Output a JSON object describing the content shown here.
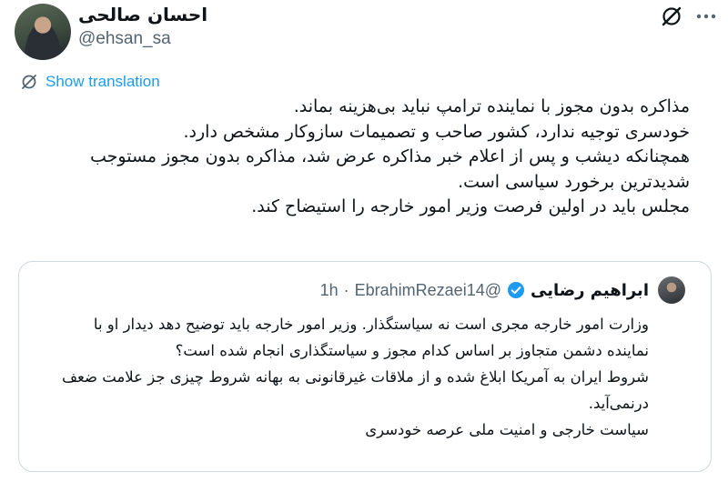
{
  "tweet": {
    "author_name": "احسان صالحی",
    "author_handle": "@ehsan_sa",
    "show_translation": "Show translation",
    "lines": [
      "مذاکره بدون مجوز با نماینده ترامپ نباید بی‌هزینه بماند.",
      "خودسری توجیه ندارد، کشور صاحب و تصمیمات سازوکار مشخص دارد.",
      "همچنانکه دیشب و پس از اعلام خبر مذاکره عرض شد، مذاکره بدون مجوز مستوجب",
      "شدیدترین برخورد سیاسی است.",
      "مجلس باید در اولین فرصت وزیر امور خارجه را استیضاح کند."
    ]
  },
  "quote": {
    "author_name": "ابراهیم رضایی",
    "author_handle": "@EbrahimRezaei14",
    "separator": "·",
    "time": "1h",
    "lines": [
      "وزارت امور خارجه مجری است نه سیاستگذار. وزیر امور خارجه باید توضیح دهد دیدار او با",
      "نماینده دشمن متجاوز بر اساس کدام مجوز و سیاستگذاری انجام شده است؟",
      "شروط ایران به آمریکا ابلاغ شده و از ملاقات غیرقانونی به بهانه شروط چیزی جز علامت ضعف",
      "درنمی‌آید.",
      "سیاست خارجی و امنیت ملی عرصه خودسری"
    ]
  },
  "icons": {
    "grok": "grok-icon",
    "more": "more-icon",
    "translate": "translate-icon",
    "verified": "verified-badge-icon"
  },
  "colors": {
    "link": "#1d9bf0",
    "secondary_text": "#536471",
    "border": "#cfd9de"
  }
}
